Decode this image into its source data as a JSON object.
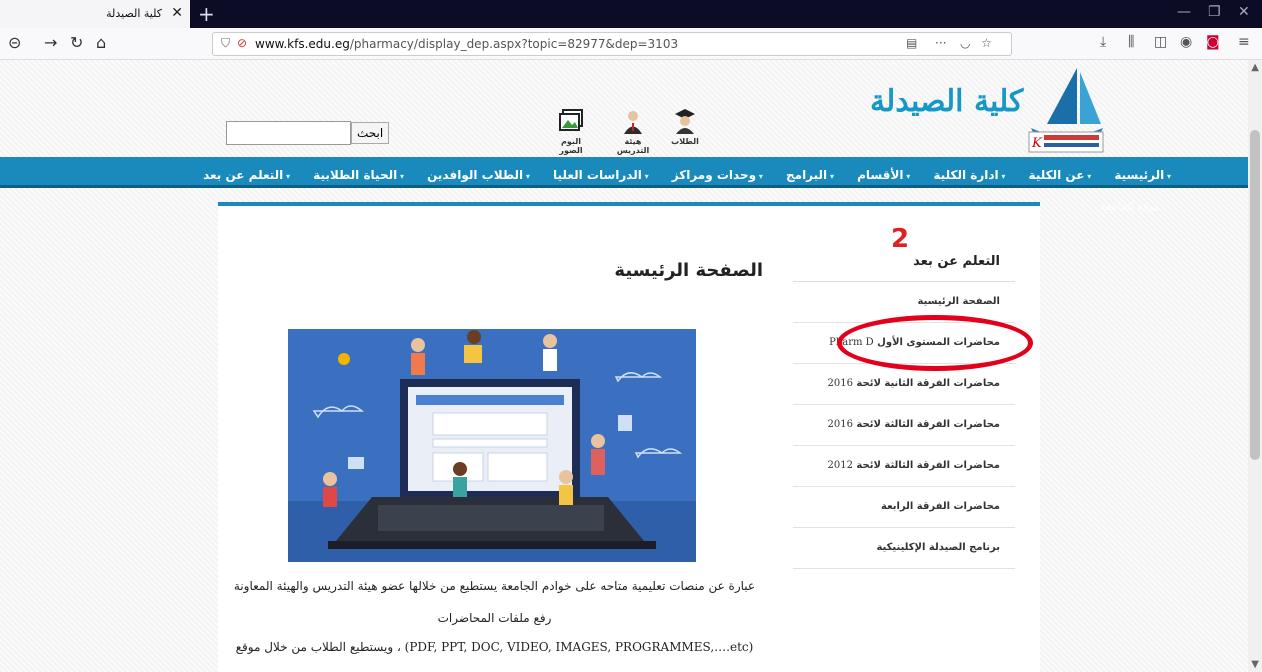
{
  "browser": {
    "tab_title": "كلية الصيدلة",
    "url_host": "www.kfs.edu.eg",
    "url_path": "/pharmacy/display_dep.aspx?topic=82977&dep=3103"
  },
  "header": {
    "brand_text": "كلية الصيدلة",
    "search_button": "ابحث",
    "search_value": "",
    "quick_links": [
      "الطلاب",
      "هيئة التدريس",
      "البوم الصور"
    ]
  },
  "main_nav": [
    "الرئيسية",
    "عن الكلية",
    "ادارة الكلية",
    "الأقسام",
    "البرامج",
    "وحدات ومراكز",
    "الدراسات العليا",
    "الطلاب الوافدين",
    "الحياة الطلابية",
    "التعلم عن بعد"
  ],
  "ghost_nav": "موقع الجامعة",
  "sidebar": {
    "title": "التعلم عن بعد",
    "items": [
      {
        "label": "الصفحة الرئيسية",
        "num": ""
      },
      {
        "label": "محاضرات المستوى الأول",
        "num": "Pharm D"
      },
      {
        "label": "محاضرات الفرقة الثانية لائحة",
        "num": "2016"
      },
      {
        "label": "محاضرات الفرقة الثالثة لائحة",
        "num": "2016"
      },
      {
        "label": "محاضرات الفرقة الثالثة لائحة",
        "num": "2012"
      },
      {
        "label": "محاضرات الفرقة الرابعة",
        "num": ""
      },
      {
        "label": "برنامج الصيدلة الإكلينيكية",
        "num": ""
      }
    ]
  },
  "content": {
    "title": "الصفحة الرئيسية",
    "paragraph1": "عبارة عن منصات تعليمية متاحه على خوادم الجامعة يستطيع من خلالها عضو هيئة التدريس والهيئة المعاونة",
    "paragraph2": "رفع ملفات المحاضرات",
    "paragraph3": "(PDF, PPT, DOC, VIDEO, IMAGES, PROGRAMMES,….etc) ، ويستطيع الطلاب من خلال موقع"
  },
  "annotation": {
    "number": "2",
    "color": "#e3001b"
  },
  "colors": {
    "nav": "#1a8abd",
    "brand": "#1597c8"
  }
}
